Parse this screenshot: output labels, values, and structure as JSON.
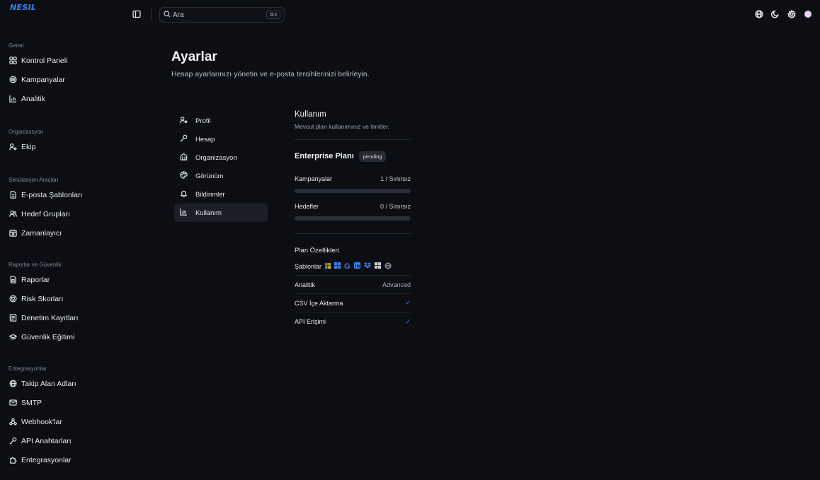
{
  "app": {
    "logo": "NESIL"
  },
  "search": {
    "placeholder": "Ara",
    "shortcut": "⌘K"
  },
  "sidebar": {
    "groups": [
      {
        "title": "Genel",
        "items": [
          {
            "label": "Kontrol Paneli",
            "icon": "dashboard-icon"
          },
          {
            "label": "Kampanyalar",
            "icon": "target-icon"
          },
          {
            "label": "Analitik",
            "icon": "chart-icon"
          }
        ]
      },
      {
        "title": "Organizasyon",
        "items": [
          {
            "label": "Ekip",
            "icon": "user-key-icon"
          }
        ]
      },
      {
        "title": "Simülasyon Araçları",
        "items": [
          {
            "label": "E-posta Şablonları",
            "icon": "file-icon"
          },
          {
            "label": "Hedef Grupları",
            "icon": "users-icon"
          },
          {
            "label": "Zamanlayıcı",
            "icon": "calendar-icon"
          }
        ]
      },
      {
        "title": "Raporlar ve Güvenlik",
        "items": [
          {
            "label": "Raporlar",
            "icon": "report-icon"
          },
          {
            "label": "Risk Skorları",
            "icon": "shield-icon"
          },
          {
            "label": "Denetim Kayıtları",
            "icon": "audit-icon"
          },
          {
            "label": "Güvenlik Eğitimi",
            "icon": "graduation-icon"
          }
        ]
      },
      {
        "title": "Entegrasyonlar",
        "items": [
          {
            "label": "Takip Alan Adları",
            "icon": "globe-icon"
          },
          {
            "label": "SMTP",
            "icon": "mail-icon"
          },
          {
            "label": "Webhook'lar",
            "icon": "webhook-icon"
          },
          {
            "label": "API Anahtarları",
            "icon": "key-icon"
          },
          {
            "label": "Entegrasyonlar",
            "icon": "puzzle-icon"
          }
        ]
      }
    ]
  },
  "page": {
    "title": "Ayarlar",
    "subtitle": "Hesap ayarlarınızı yönetin ve e-posta tercihlerinizi belirleyin."
  },
  "settings_nav": [
    {
      "label": "Profil",
      "icon": "user-key-icon"
    },
    {
      "label": "Hesap",
      "icon": "key-icon"
    },
    {
      "label": "Organizasyon",
      "icon": "building-icon"
    },
    {
      "label": "Görünüm",
      "icon": "palette-icon"
    },
    {
      "label": "Bildirimler",
      "icon": "bell-icon"
    },
    {
      "label": "Kullanım",
      "icon": "chart-icon",
      "active": true
    }
  ],
  "usage": {
    "title": "Kullanım",
    "subtitle": "Mevcut plan kullanımınız ve limitler.",
    "plan_name": "Enterprise Planı",
    "plan_status": "pending",
    "meters": [
      {
        "label": "Kampanyalar",
        "value": "1 / Sınırsız",
        "fraction": 0
      },
      {
        "label": "Hedefler",
        "value": "0 / Sınırsız",
        "fraction": 0
      }
    ],
    "features_title": "Plan Özellikleri",
    "features": {
      "templates_label": "Şablonlar",
      "analytics_label": "Analitik",
      "analytics_value": "Advanced",
      "csv_label": "CSV İçe Aktarma",
      "api_label": "API Erişimi",
      "check": "✓"
    },
    "template_icons": [
      "microsoft-icon",
      "teams-icon",
      "google-icon",
      "linkedin-icon",
      "dropbox-icon",
      "windows-icon",
      "globe-icon"
    ]
  },
  "colors": {
    "accent": "#3b82f6",
    "background": "#0c0e13"
  }
}
